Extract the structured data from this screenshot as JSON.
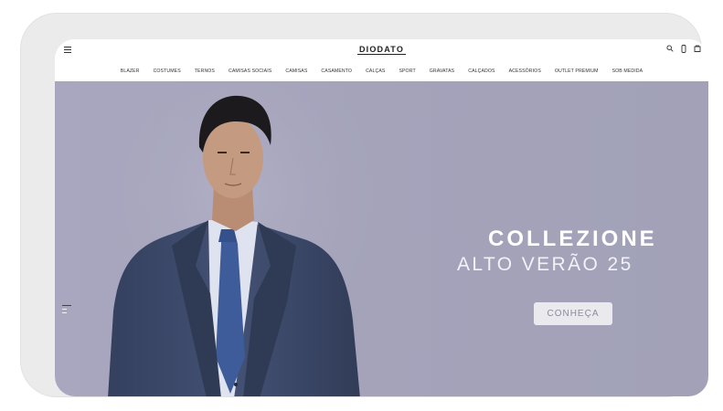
{
  "header": {
    "logo_text": "DIODATO",
    "icons": [
      "menu-icon",
      "search-icon",
      "account-icon",
      "bag-icon"
    ]
  },
  "nav": {
    "items": [
      {
        "label": "BLAZER"
      },
      {
        "label": "COSTUMES"
      },
      {
        "label": "TERNOS"
      },
      {
        "label": "CAMISAS SOCIAIS"
      },
      {
        "label": "CAMISAS"
      },
      {
        "label": "CASAMENTO"
      },
      {
        "label": "CALÇAS"
      },
      {
        "label": "SPORT"
      },
      {
        "label": "GRAVATAS"
      },
      {
        "label": "CALÇADOS"
      },
      {
        "label": "ACESSÓRIOS"
      },
      {
        "label": "OUTLET PREMIUM"
      },
      {
        "label": "SOB MEDIDA"
      }
    ]
  },
  "hero": {
    "title": "COLLEZIONE",
    "subtitle": "ALTO VERÃO 25",
    "cta_label": "CONHEÇA",
    "background_color": "#a4a3ba",
    "suit_color": "#3b4866",
    "tie_color": "#3f5c9a"
  }
}
